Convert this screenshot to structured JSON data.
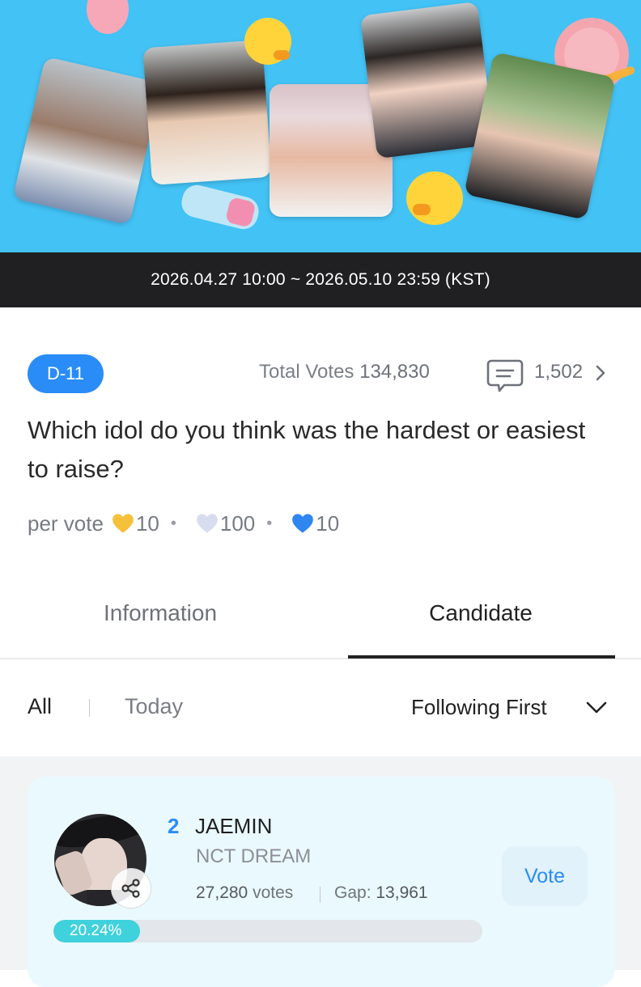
{
  "date_range": "2026.04.27 10:00 ~ 2026.05.10 23:59 (KST)",
  "poll": {
    "dday": "D-11",
    "total_votes_label": "Total Votes",
    "total_votes_value": "134,830",
    "comment_count": "1,502",
    "question": "Which idol do you think was the hardest or easiest to raise?",
    "per_vote_label": "per vote",
    "per_vote": [
      {
        "icon": "gold-heart-icon",
        "color": "#f6c13a",
        "value": "10"
      },
      {
        "icon": "silver-heart-icon",
        "color": "#d8dcef",
        "value": "100"
      },
      {
        "icon": "blue-heart-icon",
        "color": "#2f86f0",
        "value": "10"
      }
    ]
  },
  "tabs": [
    {
      "label": "Information",
      "active": false
    },
    {
      "label": "Candidate",
      "active": true
    }
  ],
  "filters": {
    "all": "All",
    "today": "Today",
    "sort": "Following First"
  },
  "candidates": [
    {
      "rank": "2",
      "name": "JAEMIN",
      "group": "NCT DREAM",
      "votes_value": "27,280",
      "votes_suffix": "votes",
      "gap_label": "Gap:",
      "gap_value": "13,961",
      "percent": "20.24%",
      "percent_value": 20.24,
      "vote_button": "Vote"
    }
  ],
  "colors": {
    "banner": "#43c2f5",
    "accent": "#2a8cf6",
    "bar_fill": "#3fd1dc"
  }
}
